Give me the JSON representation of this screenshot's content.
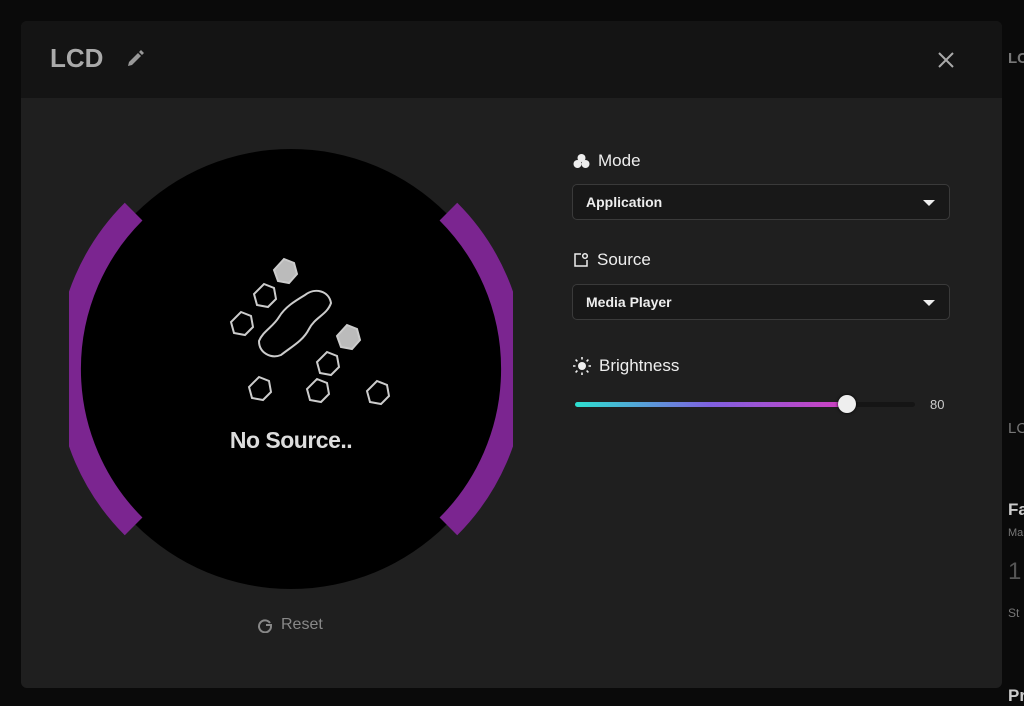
{
  "header": {
    "title": "LCD"
  },
  "preview": {
    "status_text": "No Source..",
    "reset_label": "Reset",
    "ring_color": "#7b2590"
  },
  "mode": {
    "label": "Mode",
    "value": "Application"
  },
  "source": {
    "label": "Source",
    "value": "Media Player"
  },
  "brightness": {
    "label": "Brightness",
    "value": 80,
    "value_text": "80"
  },
  "background": {
    "right_1": "LC",
    "right_2": "LC",
    "right_3": "Fa",
    "right_4": "Ma",
    "right_5": "1",
    "right_6": "St",
    "right_7": "Pr"
  }
}
